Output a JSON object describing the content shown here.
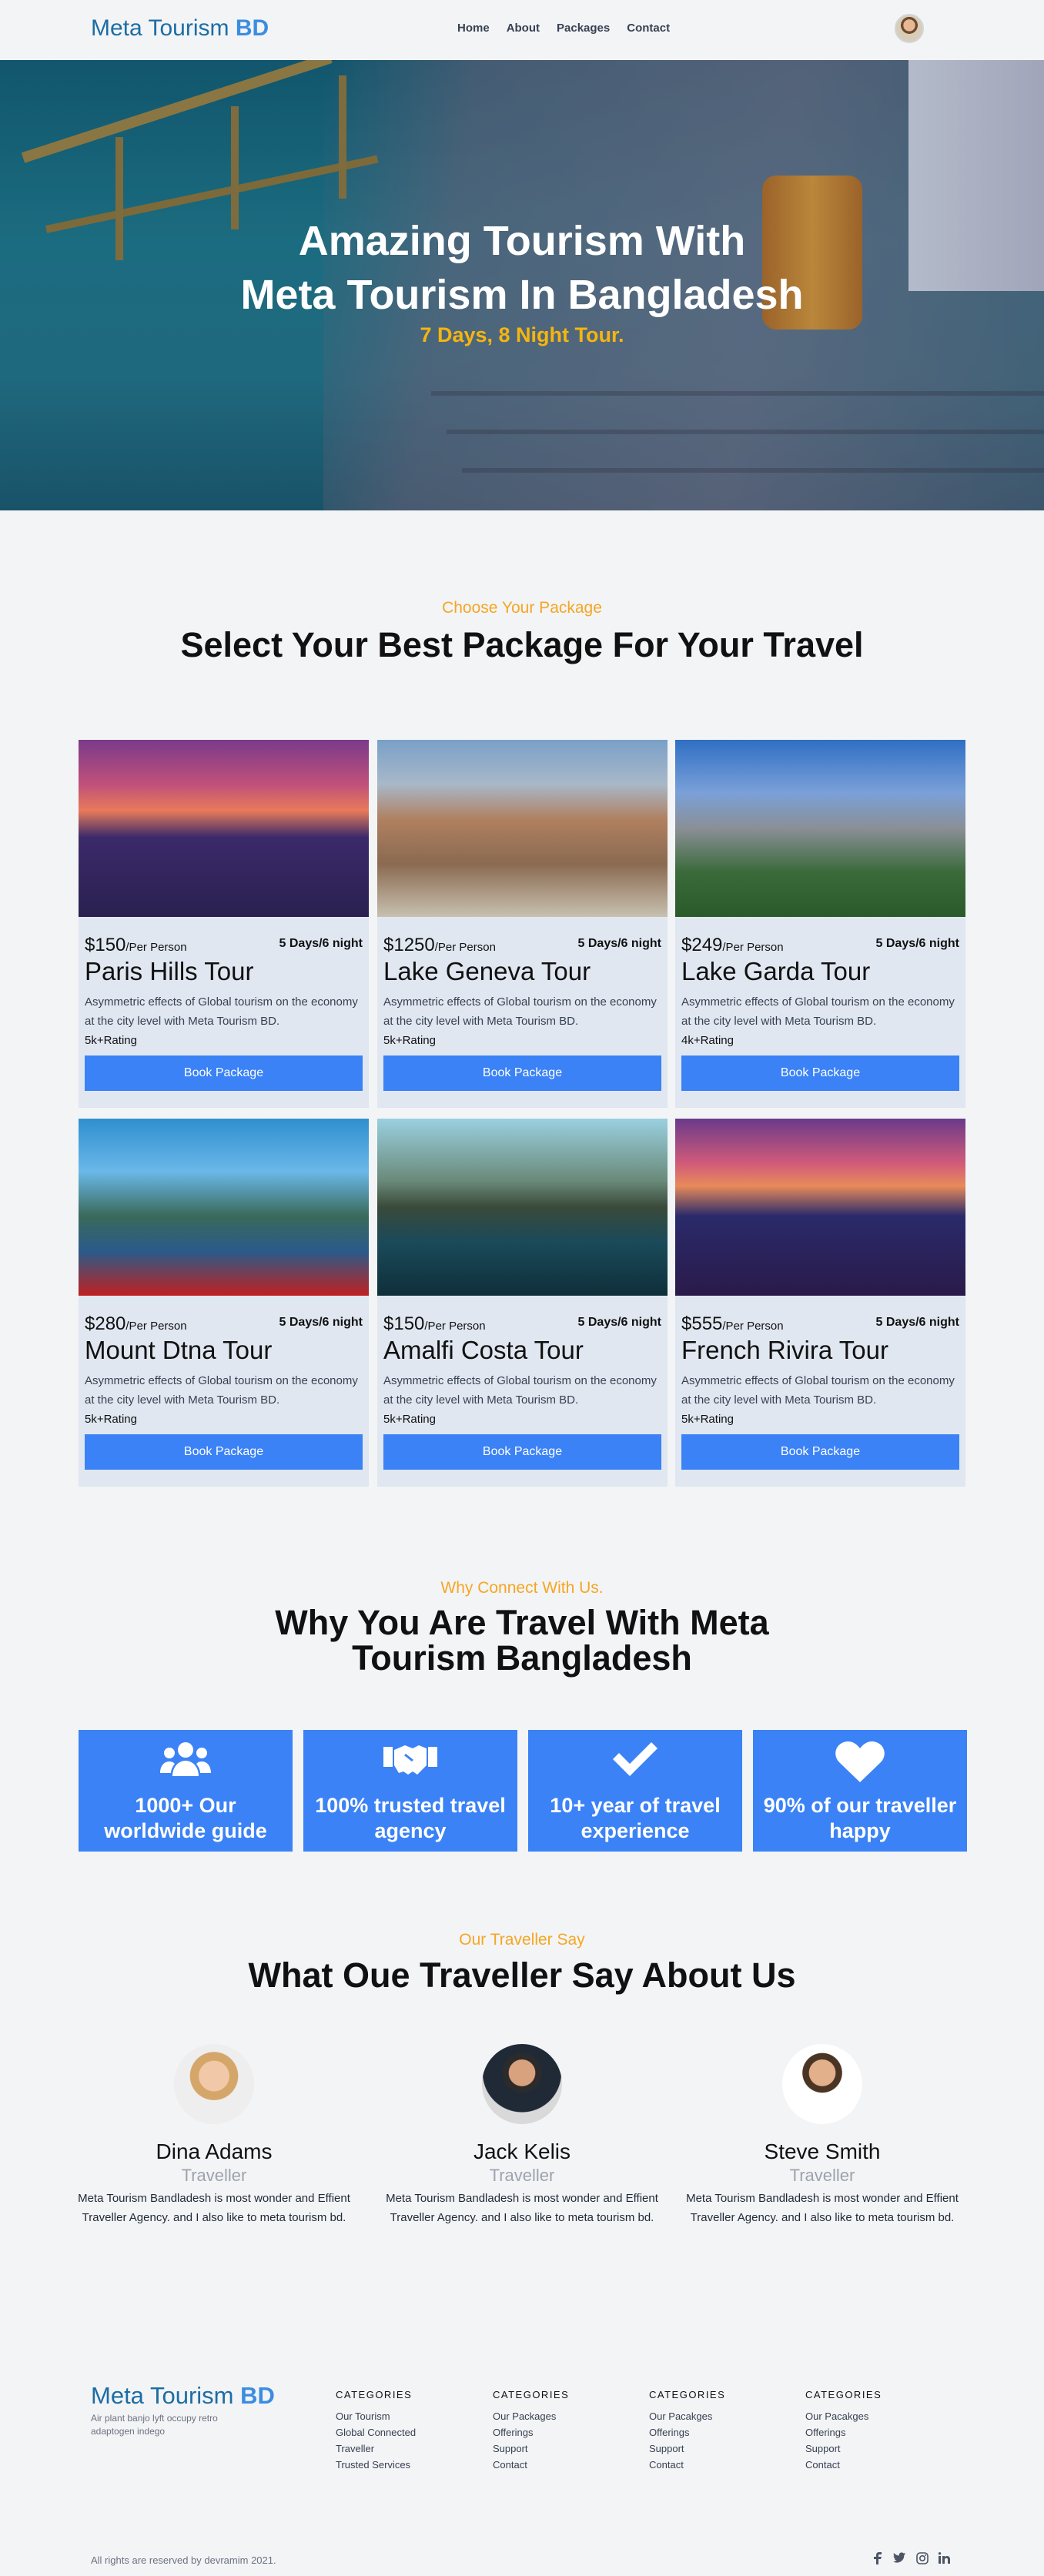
{
  "nav": {
    "brand_main": "Meta Tourism",
    "brand_accent": "BD",
    "links": [
      "Home",
      "About",
      "Packages",
      "Contact"
    ]
  },
  "hero": {
    "title_line1": "Amazing Tourism With",
    "title_line2": "Meta Tourism In Bangladesh",
    "subtitle": "7 Days, 8 Night Tour."
  },
  "packages": {
    "eyebrow": "Choose Your Package",
    "heading": "Select Your Best Package For Your Travel",
    "per": "/Per Person",
    "button": "Book Package",
    "items": [
      {
        "price": "$150",
        "duration": "5 Days/6 night",
        "title": "Paris Hills Tour",
        "desc": "Asymmetric effects of Global tourism on the economy at the city level with Meta Tourism BD.",
        "rating": "5k+Rating"
      },
      {
        "price": "$1250",
        "duration": "5 Days/6 night",
        "title": "Lake Geneva Tour",
        "desc": "Asymmetric effects of Global tourism on the economy at the city level with Meta Tourism BD.",
        "rating": "5k+Rating"
      },
      {
        "price": "$249",
        "duration": "5 Days/6 night",
        "title": "Lake Garda Tour",
        "desc": "Asymmetric effects of Global tourism on the economy at the city level with Meta Tourism BD.",
        "rating": "4k+Rating"
      },
      {
        "price": "$280",
        "duration": "5 Days/6 night",
        "title": "Mount Dtna Tour",
        "desc": "Asymmetric effects of Global tourism on the economy at the city level with Meta Tourism BD.",
        "rating": "5k+Rating"
      },
      {
        "price": "$150",
        "duration": "5 Days/6 night",
        "title": "Amalfi Costa Tour",
        "desc": "Asymmetric effects of Global tourism on the economy at the city level with Meta Tourism BD.",
        "rating": "5k+Rating"
      },
      {
        "price": "$555",
        "duration": "5 Days/6 night",
        "title": "French Rivira Tour",
        "desc": "Asymmetric effects of Global tourism on the economy at the city level with Meta Tourism BD.",
        "rating": "5k+Rating"
      }
    ]
  },
  "why": {
    "eyebrow": "Why Connect With Us.",
    "heading_line1": "Why You Are Travel With Meta",
    "heading_line2": "Tourism Bangladesh",
    "features": [
      {
        "icon": "users-icon",
        "text": "1000+ Our worldwide guide"
      },
      {
        "icon": "handshake-icon",
        "text": "100% trusted travel agency"
      },
      {
        "icon": "check-icon",
        "text": "10+ year of travel experience"
      },
      {
        "icon": "heart-icon",
        "text": "90% of our traveller happy"
      }
    ]
  },
  "testimonials": {
    "eyebrow": "Our Traveller Say",
    "heading": "What Oue Traveller Say About Us",
    "items": [
      {
        "name": "Dina Adams",
        "role": "Traveller",
        "quote": "Meta Tourism Bandladesh is most wonder and Effient Traveller Agency. and I also like to meta tourism bd."
      },
      {
        "name": "Jack Kelis",
        "role": "Traveller",
        "quote": "Meta Tourism Bandladesh is most wonder and Effient Traveller Agency. and I also like to meta tourism bd."
      },
      {
        "name": "Steve Smith",
        "role": "Traveller",
        "quote": "Meta Tourism Bandladesh is most wonder and Effient Traveller Agency. and I also like to meta tourism bd."
      }
    ]
  },
  "footer": {
    "brand_main": "Meta Tourism",
    "brand_accent": "BD",
    "tagline": "Air plant banjo lyft occupy retro adaptogen indego",
    "columns": [
      {
        "title": "CATEGORIES",
        "links": [
          "Our Tourism",
          "Global Connected",
          "Traveller",
          "Trusted Services"
        ]
      },
      {
        "title": "CATEGORIES",
        "links": [
          "Our Packages",
          "Offerings",
          "Support",
          "Contact"
        ]
      },
      {
        "title": "CATEGORIES",
        "links": [
          "Our Pacakges",
          "Offerings",
          "Support",
          "Contact"
        ]
      },
      {
        "title": "CATEGORIES",
        "links": [
          "Our Pacakges",
          "Offerings",
          "Support",
          "Contact"
        ]
      }
    ],
    "copyright": "All rights are reserved by devramim 2021.",
    "social": [
      "facebook-icon",
      "twitter-icon",
      "instagram-icon",
      "linkedin-icon"
    ]
  }
}
